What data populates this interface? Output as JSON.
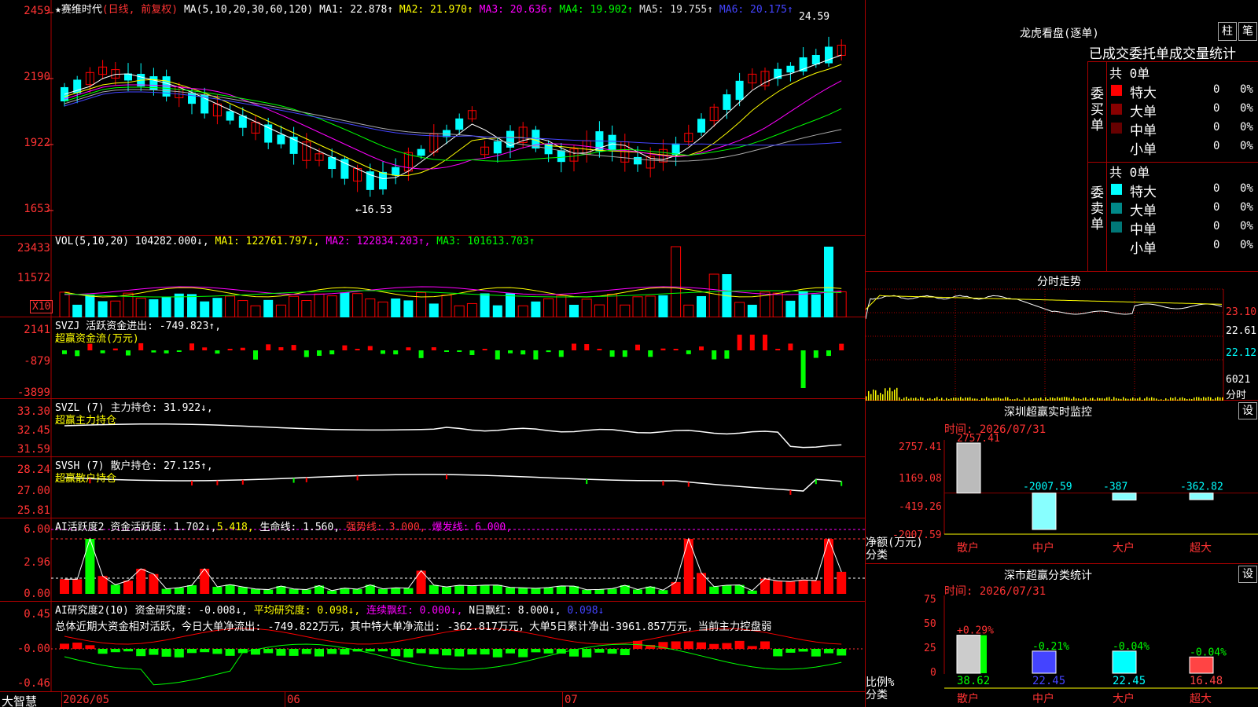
{
  "main": {
    "title": "★赛维时代",
    "mode": "(日线, 前复权)",
    "ma_header": "MA(5,10,20,30,60,120)",
    "ma": [
      {
        "label": "MA1: 22.878↑",
        "color": "#fff"
      },
      {
        "label": "MA2: 21.970↑",
        "color": "#ff0"
      },
      {
        "label": "MA3: 20.636↑",
        "color": "#f0f"
      },
      {
        "label": "MA4: 19.902↑",
        "color": "#0f0"
      },
      {
        "label": "MA5: 19.755↑",
        "color": "#ddd"
      },
      {
        "label": "MA6: 20.175↑",
        "color": "#44f"
      }
    ],
    "y_ticks": [
      "2459",
      "2190",
      "1922",
      "1653"
    ],
    "high_label": "24.59",
    "low_label": "16.53",
    "x_labels": [
      "2026/05",
      "06",
      "07"
    ],
    "brand": "大智慧"
  },
  "vol": {
    "header": "VOL(5,10,20)",
    "value": "104282.000↓,",
    "ma1": "MA1: 122761.797↓,",
    "ma2": "MA2: 122834.203↑,",
    "ma3": "MA3: 101613.703↑",
    "y_ticks": [
      "23433",
      "11572"
    ],
    "unit": "X10"
  },
  "svzj": {
    "header": "SVZJ  活跃资金进出: -749.823↑,",
    "sub": "超赢资金流(万元)",
    "y_ticks": [
      "2141",
      "-879",
      "-3899"
    ]
  },
  "svzl": {
    "header": "SVZL (7) 主力持仓: 31.922↓,",
    "sub": "超赢主力持仓",
    "y_ticks": [
      "33.30",
      "32.45",
      "31.59"
    ]
  },
  "svsh": {
    "header": "SVSH (7) 散户持仓: 27.125↑,",
    "sub": "超赢散户持仓",
    "y_ticks": [
      "28.24",
      "27.00",
      "25.81"
    ]
  },
  "ai1": {
    "header_a": "AI活跃度2 资金活跃度: 1.702↓,",
    "header_b": "5.418,",
    "header_c": "生命线: 1.560,",
    "header_d": "强势线: 3.000,",
    "header_e": "爆发线: 6.000,",
    "y_ticks": [
      "6.00",
      "2.96",
      "0.00"
    ]
  },
  "ai2": {
    "header_a": "AI研究度2(10) 资金研究度: -0.008↓,",
    "header_b": "平均研究度: 0.098↓,",
    "header_c": "连续飘红: 0.000↓,",
    "header_d": "N日飘红: 8.000↓,",
    "header_e": "0.098↓",
    "summary": "总体近期大资金相对活跃，今日大单净流出: -749.822万元，其中特大单净流出: -362.817万元，大单5日累计净出-3961.857万元，当前主力控盘弱",
    "y_ticks": [
      "0.45",
      "-0.00",
      "-0.46"
    ]
  },
  "lhb": {
    "title": "龙虎看盘(逐单)",
    "btn1": "柱",
    "btn2": "笔",
    "tabs": "已成交委托单成交量统计",
    "buy_total": "共 0单",
    "sell_total": "共 0单",
    "buy_side": "委买单",
    "sell_side": "委卖单",
    "rows": [
      {
        "name": "特大",
        "count": "0",
        "pct": "0%"
      },
      {
        "name": "大单",
        "count": "0",
        "pct": "0%"
      },
      {
        "name": "中单",
        "count": "0",
        "pct": "0%"
      },
      {
        "name": "小单",
        "count": "0",
        "pct": "0%"
      }
    ],
    "buy_colors": [
      "#f00",
      "#800",
      "#600",
      "#000"
    ],
    "sell_colors": [
      "#0ff",
      "#088",
      "#077",
      "#000"
    ]
  },
  "fs": {
    "title": "分时走势",
    "y_ticks": [
      "23.10",
      "22.61",
      "22.12",
      "6021"
    ],
    "unit": "分时"
  },
  "mon": {
    "title": "深圳超赢实时监控",
    "btn": "设",
    "time": "时间: 2026/07/31",
    "y_ticks": [
      "2757.41",
      "1169.08",
      "-419.26",
      "-2007.59"
    ],
    "ylabel_a": "净额(万元)",
    "ylabel_b": "分类",
    "bars": [
      {
        "cat": "散户",
        "value": 2757.41,
        "label": "2757.41"
      },
      {
        "cat": "中户",
        "value": -2007.59,
        "label": "-2007.59"
      },
      {
        "cat": "大户",
        "value": -387,
        "label": "-387"
      },
      {
        "cat": "超大",
        "value": -362.82,
        "label": "-362.82"
      }
    ]
  },
  "cls": {
    "title": "深市超赢分类统计",
    "btn": "设",
    "time": "时间: 2026/07/31",
    "y_ticks": [
      "75",
      "50",
      "25",
      "0"
    ],
    "ylabel_a": "比例%",
    "ylabel_b": "分类",
    "bars": [
      {
        "cat": "散户",
        "value": 38.62,
        "label": "38.62",
        "change": "+0.29%",
        "color": "#ccc"
      },
      {
        "cat": "中户",
        "value": 22.45,
        "label": "22.45",
        "change": "-0.21%",
        "color": "#44f"
      },
      {
        "cat": "大户",
        "value": 22.45,
        "label": "22.45",
        "change": "-0.04%",
        "color": "#0ff"
      },
      {
        "cat": "超大",
        "value": 16.48,
        "label": "16.48",
        "change": "-0.04%",
        "color": "#f44"
      }
    ]
  },
  "colors": {
    "up": "#f00",
    "down": "#0ff",
    "grid": "#a00"
  }
}
